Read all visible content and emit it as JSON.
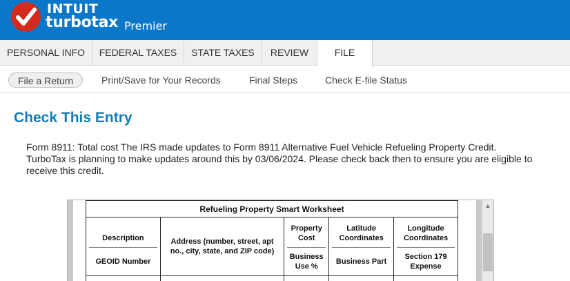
{
  "brand": {
    "intuit": "INTUIT",
    "turbotax": "turbotax",
    "edition": "Premier"
  },
  "tabs": [
    {
      "label": "PERSONAL INFO"
    },
    {
      "label": "FEDERAL TAXES"
    },
    {
      "label": "STATE TAXES"
    },
    {
      "label": "REVIEW"
    },
    {
      "label": "FILE",
      "active": true
    }
  ],
  "subnav": [
    {
      "label": "File a Return",
      "active": true
    },
    {
      "label": "Print/Save for Your Records"
    },
    {
      "label": "Final Steps"
    },
    {
      "label": "Check E-file Status"
    }
  ],
  "main": {
    "title": "Check This Entry",
    "message": "Form 8911: Total cost The IRS made updates to Form 8911 Alternative Fuel Vehicle Refueling Property Credit. TurboTax is planning to make updates around this by 03/06/2024. Please check back then to ensure you are eligible to receive this credit."
  },
  "worksheet": {
    "title": "Refueling Property Smart Worksheet",
    "columns": [
      {
        "top": "Description",
        "bottom": "GEOID Number"
      },
      {
        "single": "Address (number, street, apt no., city, state, and ZIP code)"
      },
      {
        "top": "Property Cost",
        "bottom": "Business Use %"
      },
      {
        "top": "Latitude Coordinates",
        "bottom": "Business Part"
      },
      {
        "top": "Longitude Coordinates",
        "bottom": "Section 179 Expense"
      }
    ]
  },
  "colors": {
    "header_blue": "#0a77c9",
    "logo_red": "#d52b1e",
    "title_blue": "#137db8"
  },
  "icons": [
    "checkmark-logo-icon",
    "scroll-up-arrow-icon"
  ]
}
